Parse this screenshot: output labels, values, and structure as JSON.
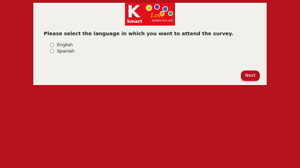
{
  "logo": {
    "letter": "K",
    "brand": "kmart",
    "script": "Love",
    "tagline": "WHERE YOU LIVE"
  },
  "survey": {
    "question": "Please select the language in which you want to attend the survey.",
    "options": [
      {
        "label": "English",
        "selected": false
      },
      {
        "label": "Spanish",
        "selected": false
      }
    ],
    "next_label": "Next"
  },
  "colors": {
    "background": "#b5121b",
    "panel": "#f2f0ec",
    "accent": "#b5121b"
  }
}
